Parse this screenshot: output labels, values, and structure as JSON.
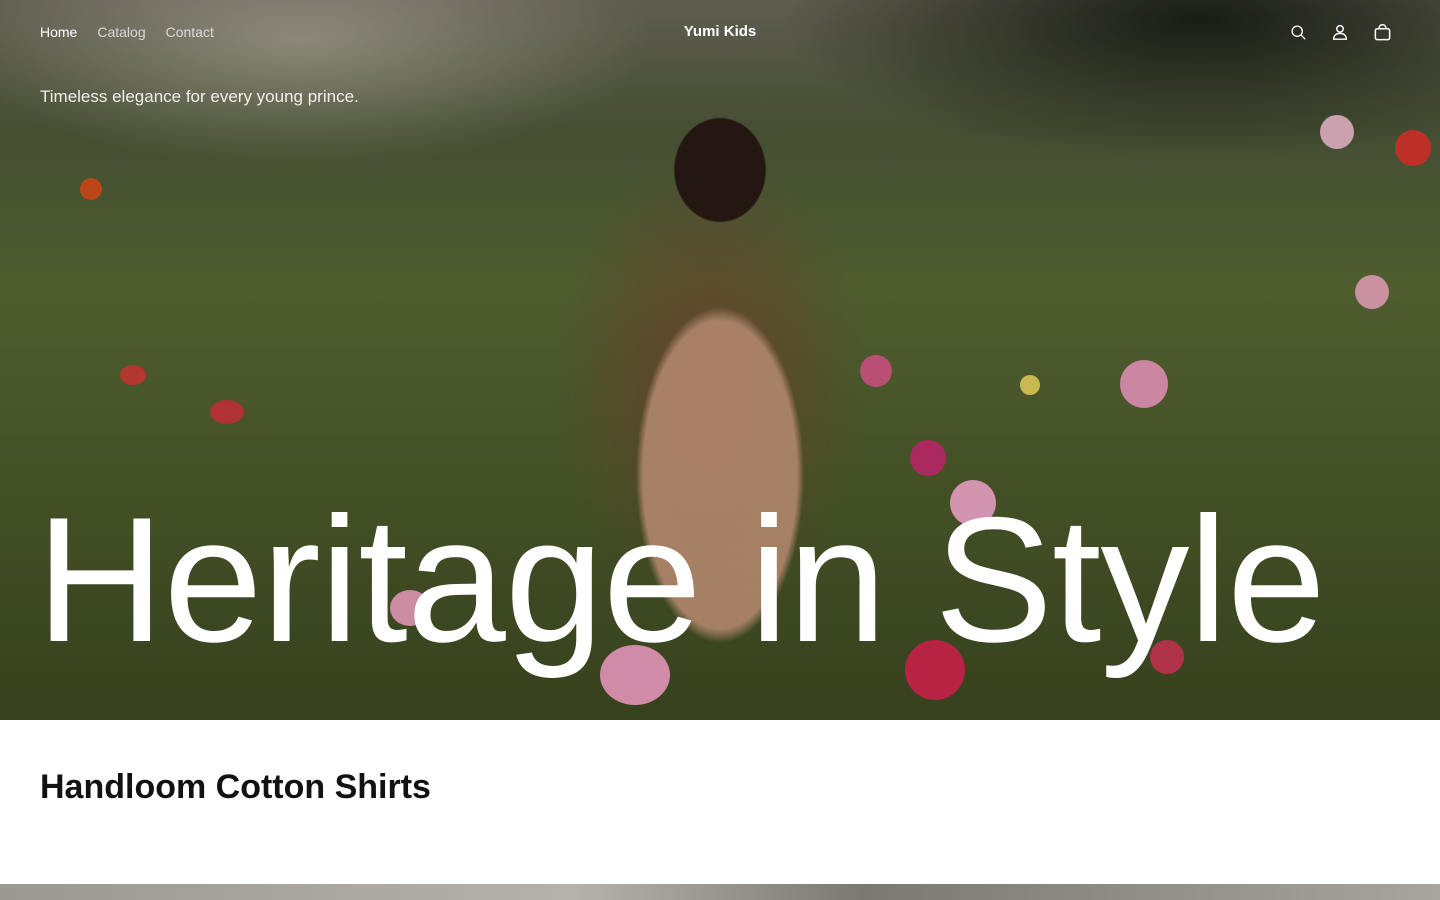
{
  "header": {
    "nav": [
      "Home",
      "Catalog",
      "Contact"
    ],
    "brand": "Yumi Kids",
    "icons": [
      "search-icon",
      "account-icon",
      "cart-icon"
    ]
  },
  "hero": {
    "tagline": "Timeless elegance for every young prince.",
    "headline": "Heritage in Style"
  },
  "collection": {
    "title": "Handloom Cotton Shirts"
  }
}
